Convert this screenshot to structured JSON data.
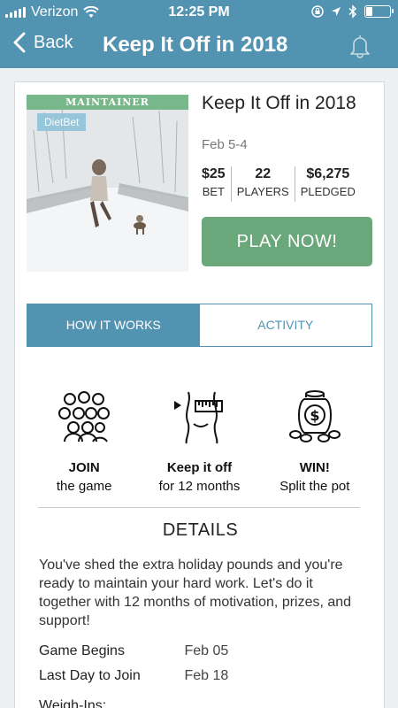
{
  "status_bar": {
    "carrier": "Verizon",
    "time": "12:25 PM"
  },
  "nav": {
    "back_label": "Back",
    "title": "Keep It Off in 2018"
  },
  "game": {
    "badge": "MAINTAINER",
    "image_logo": "DietBet",
    "title": "Keep It Off in 2018",
    "dates": "Feb 5-4",
    "stats": [
      {
        "value": "$25",
        "label": "BET"
      },
      {
        "value": "22",
        "label": "PLAYERS"
      },
      {
        "value": "$6,275",
        "label": "PLEDGED"
      }
    ],
    "play_label": "PLAY NOW!"
  },
  "tabs": [
    {
      "label": "HOW IT WORKS",
      "active": true
    },
    {
      "label": "ACTIVITY",
      "active": false
    }
  ],
  "steps": [
    {
      "icon": "group-icon",
      "title": "JOIN",
      "subtitle": "the game"
    },
    {
      "icon": "waist-measure-icon",
      "title": "Keep it off",
      "subtitle": "for 12 months"
    },
    {
      "icon": "money-jar-icon",
      "title": "WIN!",
      "subtitle": "Split the pot"
    }
  ],
  "details": {
    "heading": "DETAILS",
    "body": "You've shed the extra holiday pounds and you're ready to maintain your hard work. Let's do it together with 12 months of motivation, prizes, and support!",
    "rows": [
      {
        "label": "Game Begins",
        "value": "Feb 05"
      },
      {
        "label": "Last Day to Join",
        "value": "Feb 18"
      },
      {
        "label": "Weigh-Ins:",
        "value": ""
      }
    ]
  },
  "colors": {
    "header": "#5193b1",
    "play_button": "#6aa87b",
    "badge": "#78b78a"
  }
}
